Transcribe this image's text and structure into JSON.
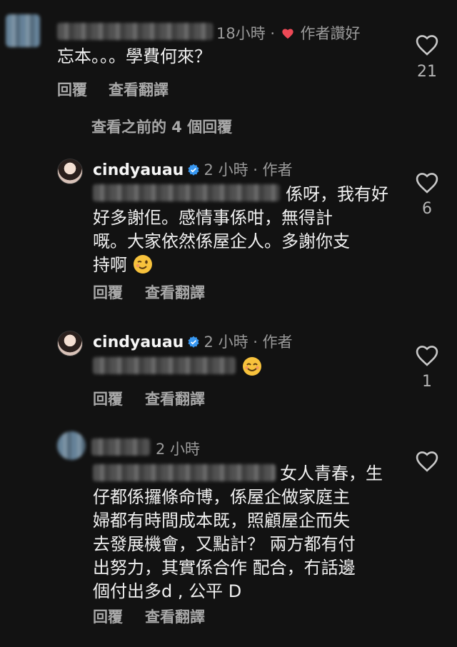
{
  "comment1": {
    "time": "18小時",
    "dot": "·",
    "author_liked": "作者讚好",
    "text": "忘本。。。學費何來？",
    "reply": "回覆",
    "translate": "查看翻譯",
    "likes": "21"
  },
  "view_previous": "查看之前的 4 個回覆",
  "reply1": {
    "username": "cindyauau",
    "meta": "2 小時 · 作者",
    "lines": [
      "係呀，我有好",
      "好多謝佢。感情事係咁，無得計",
      "嘅。大家依然係屋企人。多謝你支",
      "持啊"
    ],
    "reply": "回覆",
    "translate": "查看翻譯",
    "likes": "6"
  },
  "reply2": {
    "username": "cindyauau",
    "meta": "2 小時 · 作者",
    "reply": "回覆",
    "translate": "查看翻譯",
    "likes": "1"
  },
  "reply3": {
    "time": "2 小時",
    "lines": [
      "女人青春，生",
      "仔都係攞條命博，係屋企做家庭主",
      "婦都有時間成本既，照顧屋企而失",
      "去發展機會，又點計？ 兩方都有付",
      "出努力，其實係合作 配合，冇話邊",
      "個付出多d , 公平 D"
    ],
    "reply": "回覆",
    "translate": "查看翻譯"
  },
  "colors": {
    "background": "#121212",
    "like_heart": "#ed4956",
    "verified": "#3897f0"
  }
}
